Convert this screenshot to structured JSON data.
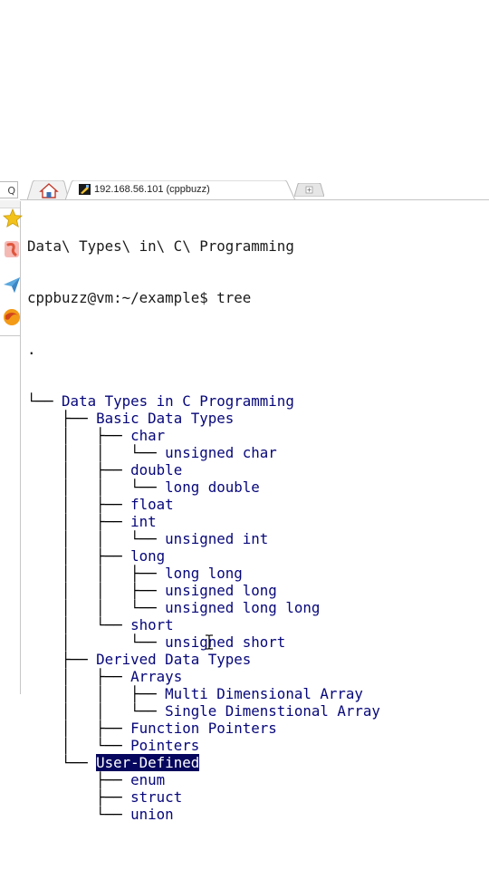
{
  "sidebar": {
    "search_glyph": "Q",
    "icons": [
      "star-icon",
      "app-icon",
      "send-icon",
      "orb-icon"
    ]
  },
  "tabs": {
    "main_tab_title": "192.168.56.101 (cppbuzz)"
  },
  "terminal": {
    "cwd_line": "Data\\ Types\\ in\\ C\\ Programming",
    "prompt": "cppbuzz@vm:~/example$ tree",
    "root": ".",
    "tree": [
      {
        "prefix": "└── ",
        "label": "Data Types in C Programming",
        "highlight": false
      },
      {
        "prefix": "    ├── ",
        "label": "Basic Data Types",
        "highlight": false
      },
      {
        "prefix": "    │   ├── ",
        "label": "char",
        "highlight": false
      },
      {
        "prefix": "    │   │   └── ",
        "label": "unsigned char",
        "highlight": false
      },
      {
        "prefix": "    │   ├── ",
        "label": "double",
        "highlight": false
      },
      {
        "prefix": "    │   │   └── ",
        "label": "long double",
        "highlight": false
      },
      {
        "prefix": "    │   ├── ",
        "label": "float",
        "highlight": false
      },
      {
        "prefix": "    │   ├── ",
        "label": "int",
        "highlight": false
      },
      {
        "prefix": "    │   │   └── ",
        "label": "unsigned int",
        "highlight": false
      },
      {
        "prefix": "    │   ├── ",
        "label": "long",
        "highlight": false
      },
      {
        "prefix": "    │   │   ├── ",
        "label": "long long",
        "highlight": false
      },
      {
        "prefix": "    │   │   ├── ",
        "label": "unsigned long",
        "highlight": false
      },
      {
        "prefix": "    │   │   └── ",
        "label": "unsigned long long",
        "highlight": false
      },
      {
        "prefix": "    │   └── ",
        "label": "short",
        "highlight": false
      },
      {
        "prefix": "    │       └── ",
        "label": "unsigned short",
        "highlight": false
      },
      {
        "prefix": "    ├── ",
        "label": "Derived Data Types",
        "highlight": false
      },
      {
        "prefix": "    │   ├── ",
        "label": "Arrays",
        "highlight": false
      },
      {
        "prefix": "    │   │   ├── ",
        "label": "Multi Dimensional Array",
        "highlight": false
      },
      {
        "prefix": "    │   │   └── ",
        "label": "Single Dimenstional Array",
        "highlight": false
      },
      {
        "prefix": "    │   ├── ",
        "label": "Function Pointers",
        "highlight": false
      },
      {
        "prefix": "    │   └── ",
        "label": "Pointers",
        "highlight": false
      },
      {
        "prefix": "    └── ",
        "label": "User-Defined",
        "highlight": true
      },
      {
        "prefix": "        ├── ",
        "label": "enum",
        "highlight": false
      },
      {
        "prefix": "        ├── ",
        "label": "struct",
        "highlight": false
      },
      {
        "prefix": "        └── ",
        "label": "union",
        "highlight": false
      }
    ]
  },
  "colors": {
    "node_text": "#06067a",
    "highlight_bg": "#06065e",
    "highlight_text": "#ffffff",
    "plain_text": "#1a1a1a"
  }
}
